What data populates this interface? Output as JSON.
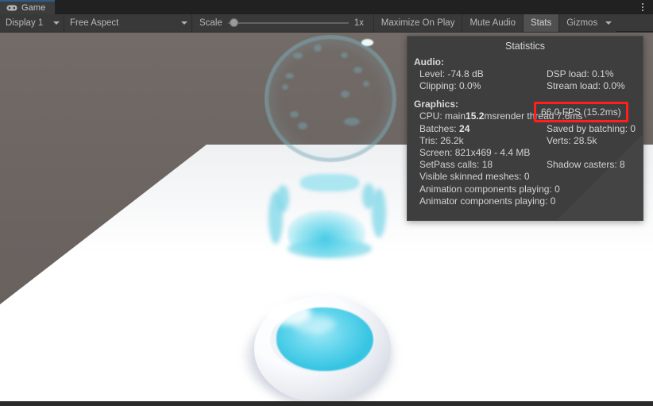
{
  "window": {
    "tab": {
      "label": "Game",
      "icon": "gamepad-icon"
    },
    "menu_icon": "kebab-menu-icon"
  },
  "toolbar": {
    "display_dropdown": {
      "label": "Display 1",
      "icon": "chevron-down-icon"
    },
    "aspect_dropdown": {
      "label": "Free Aspect",
      "icon": "chevron-down-icon"
    },
    "scale": {
      "label": "Scale",
      "value": "1x",
      "slider_position_percent": 0
    },
    "maximize_on_play": "Maximize On Play",
    "mute_audio": "Mute Audio",
    "stats": "Stats",
    "gizmos": "Gizmos",
    "gizmos_caret_icon": "chevron-down-icon",
    "stats_active": true
  },
  "statistics": {
    "title": "Statistics",
    "audio": {
      "heading": "Audio:",
      "level": "Level: -74.8 dB",
      "clipping": "Clipping: 0.0%",
      "dsp_load": "DSP load: 0.1%",
      "stream_load": "Stream load: 0.0%"
    },
    "graphics": {
      "heading": "Graphics:",
      "fps": "66.0 FPS (15.2ms)",
      "cpu_prefix": "CPU: main ",
      "cpu_main_value": "15.2",
      "cpu_main_unit": "ms",
      "render_thread": "  render thread 7.6ms",
      "batches_prefix": "Batches: ",
      "batches_value": "24",
      "saved_by_batching": "Saved by batching: 0",
      "tris": "Tris: 26.2k",
      "verts": "Verts: 28.5k",
      "screen": "Screen: 821x469 - 4.4 MB",
      "setpass_calls": "SetPass calls: 18",
      "shadow_casters": "Shadow casters: 8",
      "visible_skinned_meshes": "Visible skinned meshes: 0",
      "animation_components": "Animation components playing: 0",
      "animator_components": "Animator components playing: 0"
    }
  },
  "annotation": {
    "highlight_color": "#ff1f1f",
    "target": "fps-readout"
  },
  "scene": {
    "background_color": "#6b6461",
    "floor_color": "#ffffff",
    "liquid_color": "#36c4e2",
    "bowl_color": "#f2f4f8",
    "objects": [
      "bubble-sphere",
      "water-splash",
      "bowl-with-liquid"
    ]
  }
}
